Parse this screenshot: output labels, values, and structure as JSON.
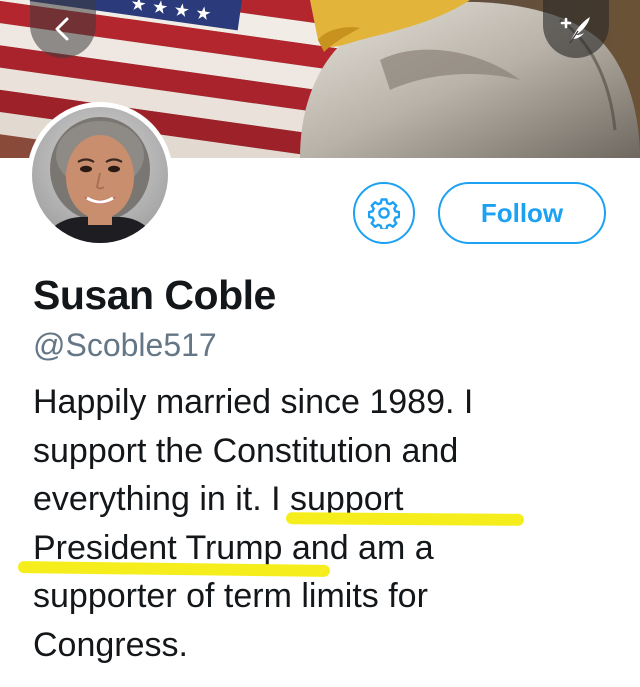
{
  "header": {
    "banner_image": "american-flag-and-eagle",
    "back_icon": "chevron-left-icon",
    "compose_icon": "compose-tweet-feather-icon"
  },
  "profile": {
    "avatar": "profile-photo",
    "settings_icon": "gear-icon",
    "follow_label": "Follow",
    "display_name": "Susan Coble",
    "handle": "@Scoble517",
    "bio_lines": [
      "Happily married since 1989. I",
      "support the Constitution and",
      "everything in it. I support",
      "President Trump and am a",
      "supporter of term limits for",
      "Congress."
    ]
  },
  "annotations": {
    "highlight_color": "#f6ee1c",
    "highlighted_text": "I support President Trump"
  },
  "colors": {
    "accent": "#1da1f2",
    "text_primary": "#14171a",
    "text_secondary": "#657786"
  }
}
